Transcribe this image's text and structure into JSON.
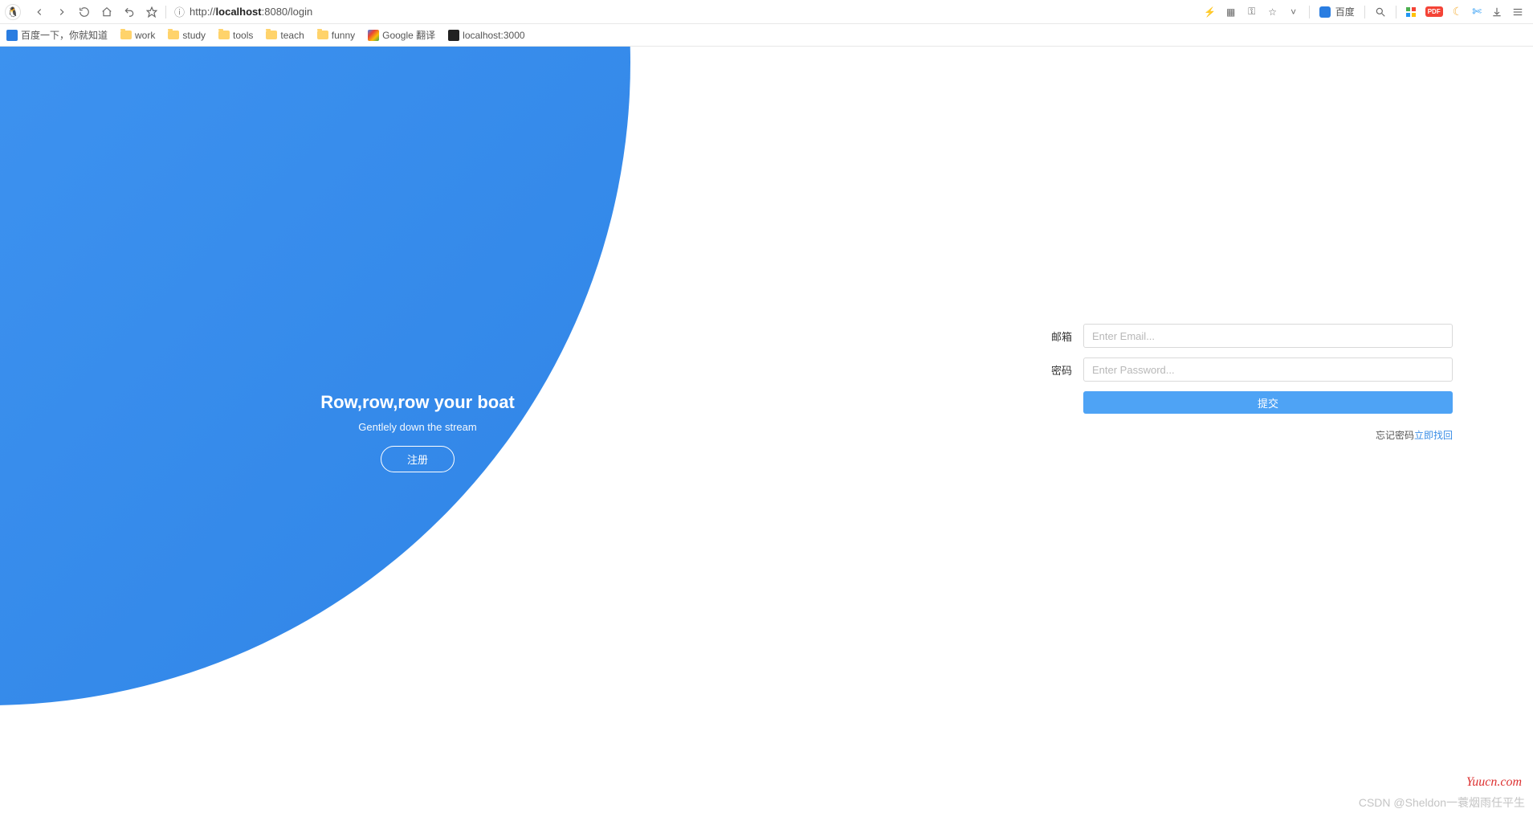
{
  "browser": {
    "url_prefix": "http://",
    "url_host": "localhost",
    "url_rest": ":8080/login",
    "search_engine": "百度",
    "bookmarks": [
      {
        "type": "site",
        "style": "blue",
        "label": "百度一下，你就知道"
      },
      {
        "type": "folder",
        "label": "work"
      },
      {
        "type": "folder",
        "label": "study"
      },
      {
        "type": "folder",
        "label": "tools"
      },
      {
        "type": "folder",
        "label": "teach"
      },
      {
        "type": "folder",
        "label": "funny"
      },
      {
        "type": "site",
        "style": "g",
        "label": "Google 翻译"
      },
      {
        "type": "site",
        "style": "dark",
        "label": "localhost:3000"
      }
    ]
  },
  "hero": {
    "title": "Row,row,row your boat",
    "subtitle": "Gentlely down the stream",
    "signup": "注册"
  },
  "form": {
    "email_label": "邮箱",
    "email_placeholder": "Enter Email...",
    "password_label": "密码",
    "password_placeholder": "Enter Password...",
    "submit": "提交",
    "forgot_text": "忘记密码",
    "forgot_link": "立即找回"
  },
  "watermark": {
    "site": "Yuucn.com",
    "author": "CSDN @Sheldon一蓑烟雨任平生"
  }
}
